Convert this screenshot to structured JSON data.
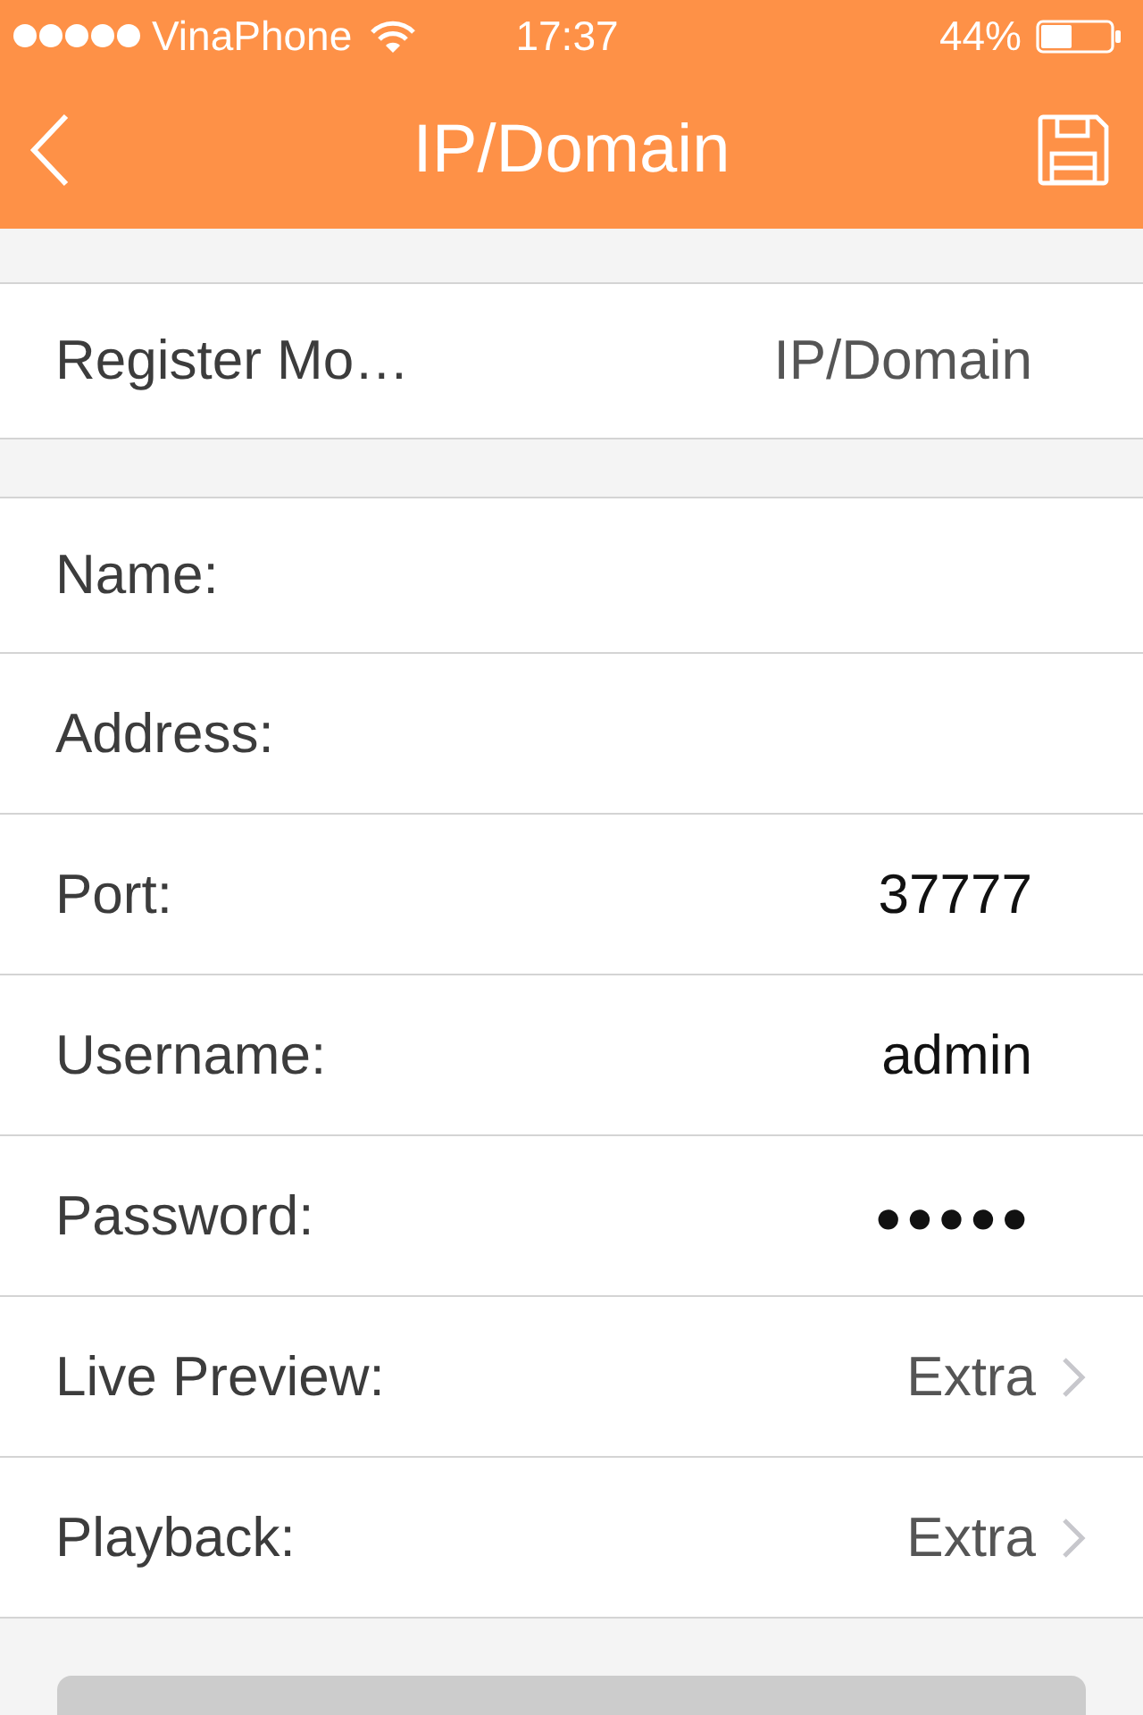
{
  "status_bar": {
    "carrier": "VinaPhone",
    "time": "17:37",
    "battery": "44%"
  },
  "nav_bar": {
    "title": "IP/Domain"
  },
  "sections": [
    {
      "rows": [
        {
          "kind": "choice",
          "label": "Register Mo…",
          "value": "IP/Domain"
        }
      ]
    },
    {
      "rows": [
        {
          "kind": "field",
          "label": "Name:"
        },
        {
          "kind": "field",
          "label": "Address:"
        },
        {
          "kind": "field",
          "label": "Port:",
          "value": "37777"
        },
        {
          "kind": "field",
          "label": "Username:",
          "value": "admin"
        },
        {
          "kind": "field",
          "label": "Password:",
          "value": "●●●●●"
        },
        {
          "kind": "disclosure",
          "label": "Live Preview:",
          "value": "Extra"
        },
        {
          "kind": "disclosure",
          "label": "Playback:",
          "value": "Extra"
        }
      ]
    }
  ]
}
